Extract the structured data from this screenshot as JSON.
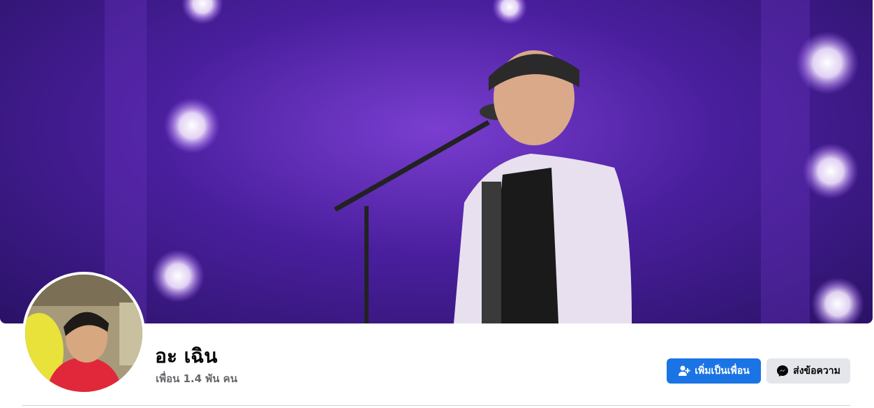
{
  "profile": {
    "name": "อะ เฉิน",
    "friends_text": "เพื่อน 1.4 พัน คน"
  },
  "actions": {
    "add_friend_label": "เพิ่มเป็นเพื่อน",
    "message_label": "ส่งข้อความ"
  },
  "icons": {
    "add_friend": "user-plus-icon",
    "message": "messenger-icon"
  },
  "colors": {
    "primary_button": "#1b74e4",
    "secondary_button": "#e4e6eb",
    "name_text": "#050505",
    "secondary_text": "#65676b"
  }
}
